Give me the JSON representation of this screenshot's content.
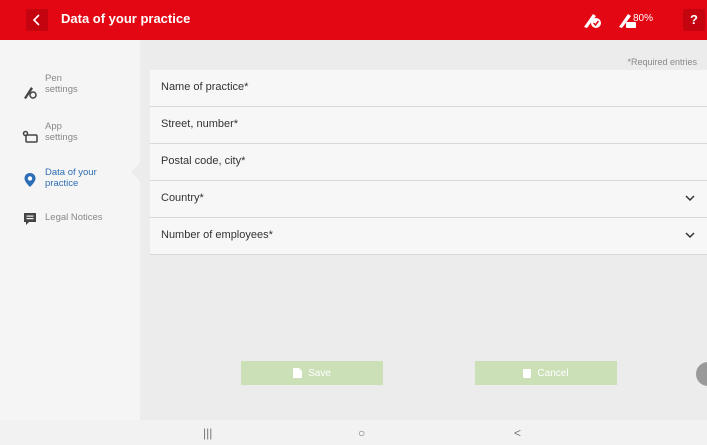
{
  "header": {
    "title": "Data of your practice",
    "battery": "80%",
    "help_label": "?",
    "back_icon": "chevron-left-icon",
    "pen_connected_icon": "pen-check-icon",
    "pen_battery_icon": "pen-battery-icon"
  },
  "sidebar": {
    "items": [
      {
        "label": "Pen\nsettings",
        "icon": "pen-icon",
        "active": false
      },
      {
        "label": "App\nsettings",
        "icon": "app-settings-icon",
        "active": false
      },
      {
        "label": "Data of your\npractice",
        "icon": "location-pin-icon",
        "active": true
      },
      {
        "label": "Legal Notices",
        "icon": "notice-icon",
        "active": false
      }
    ]
  },
  "form": {
    "required_note": "*Required entries",
    "fields": [
      {
        "label": "Name of practice*"
      },
      {
        "label": "Street, number*"
      },
      {
        "label": "Postal code, city*"
      },
      {
        "label": "Country*",
        "dropdown": true
      },
      {
        "label": "Number of employees*",
        "dropdown": true
      }
    ],
    "save_label": "Save",
    "cancel_label": "Cancel"
  },
  "nav": {
    "recent": "|||",
    "home": "○",
    "back": "<"
  },
  "colors": {
    "accent": "#e30613",
    "active_blue": "#2d6db5",
    "button_green": "#cce0b8"
  }
}
